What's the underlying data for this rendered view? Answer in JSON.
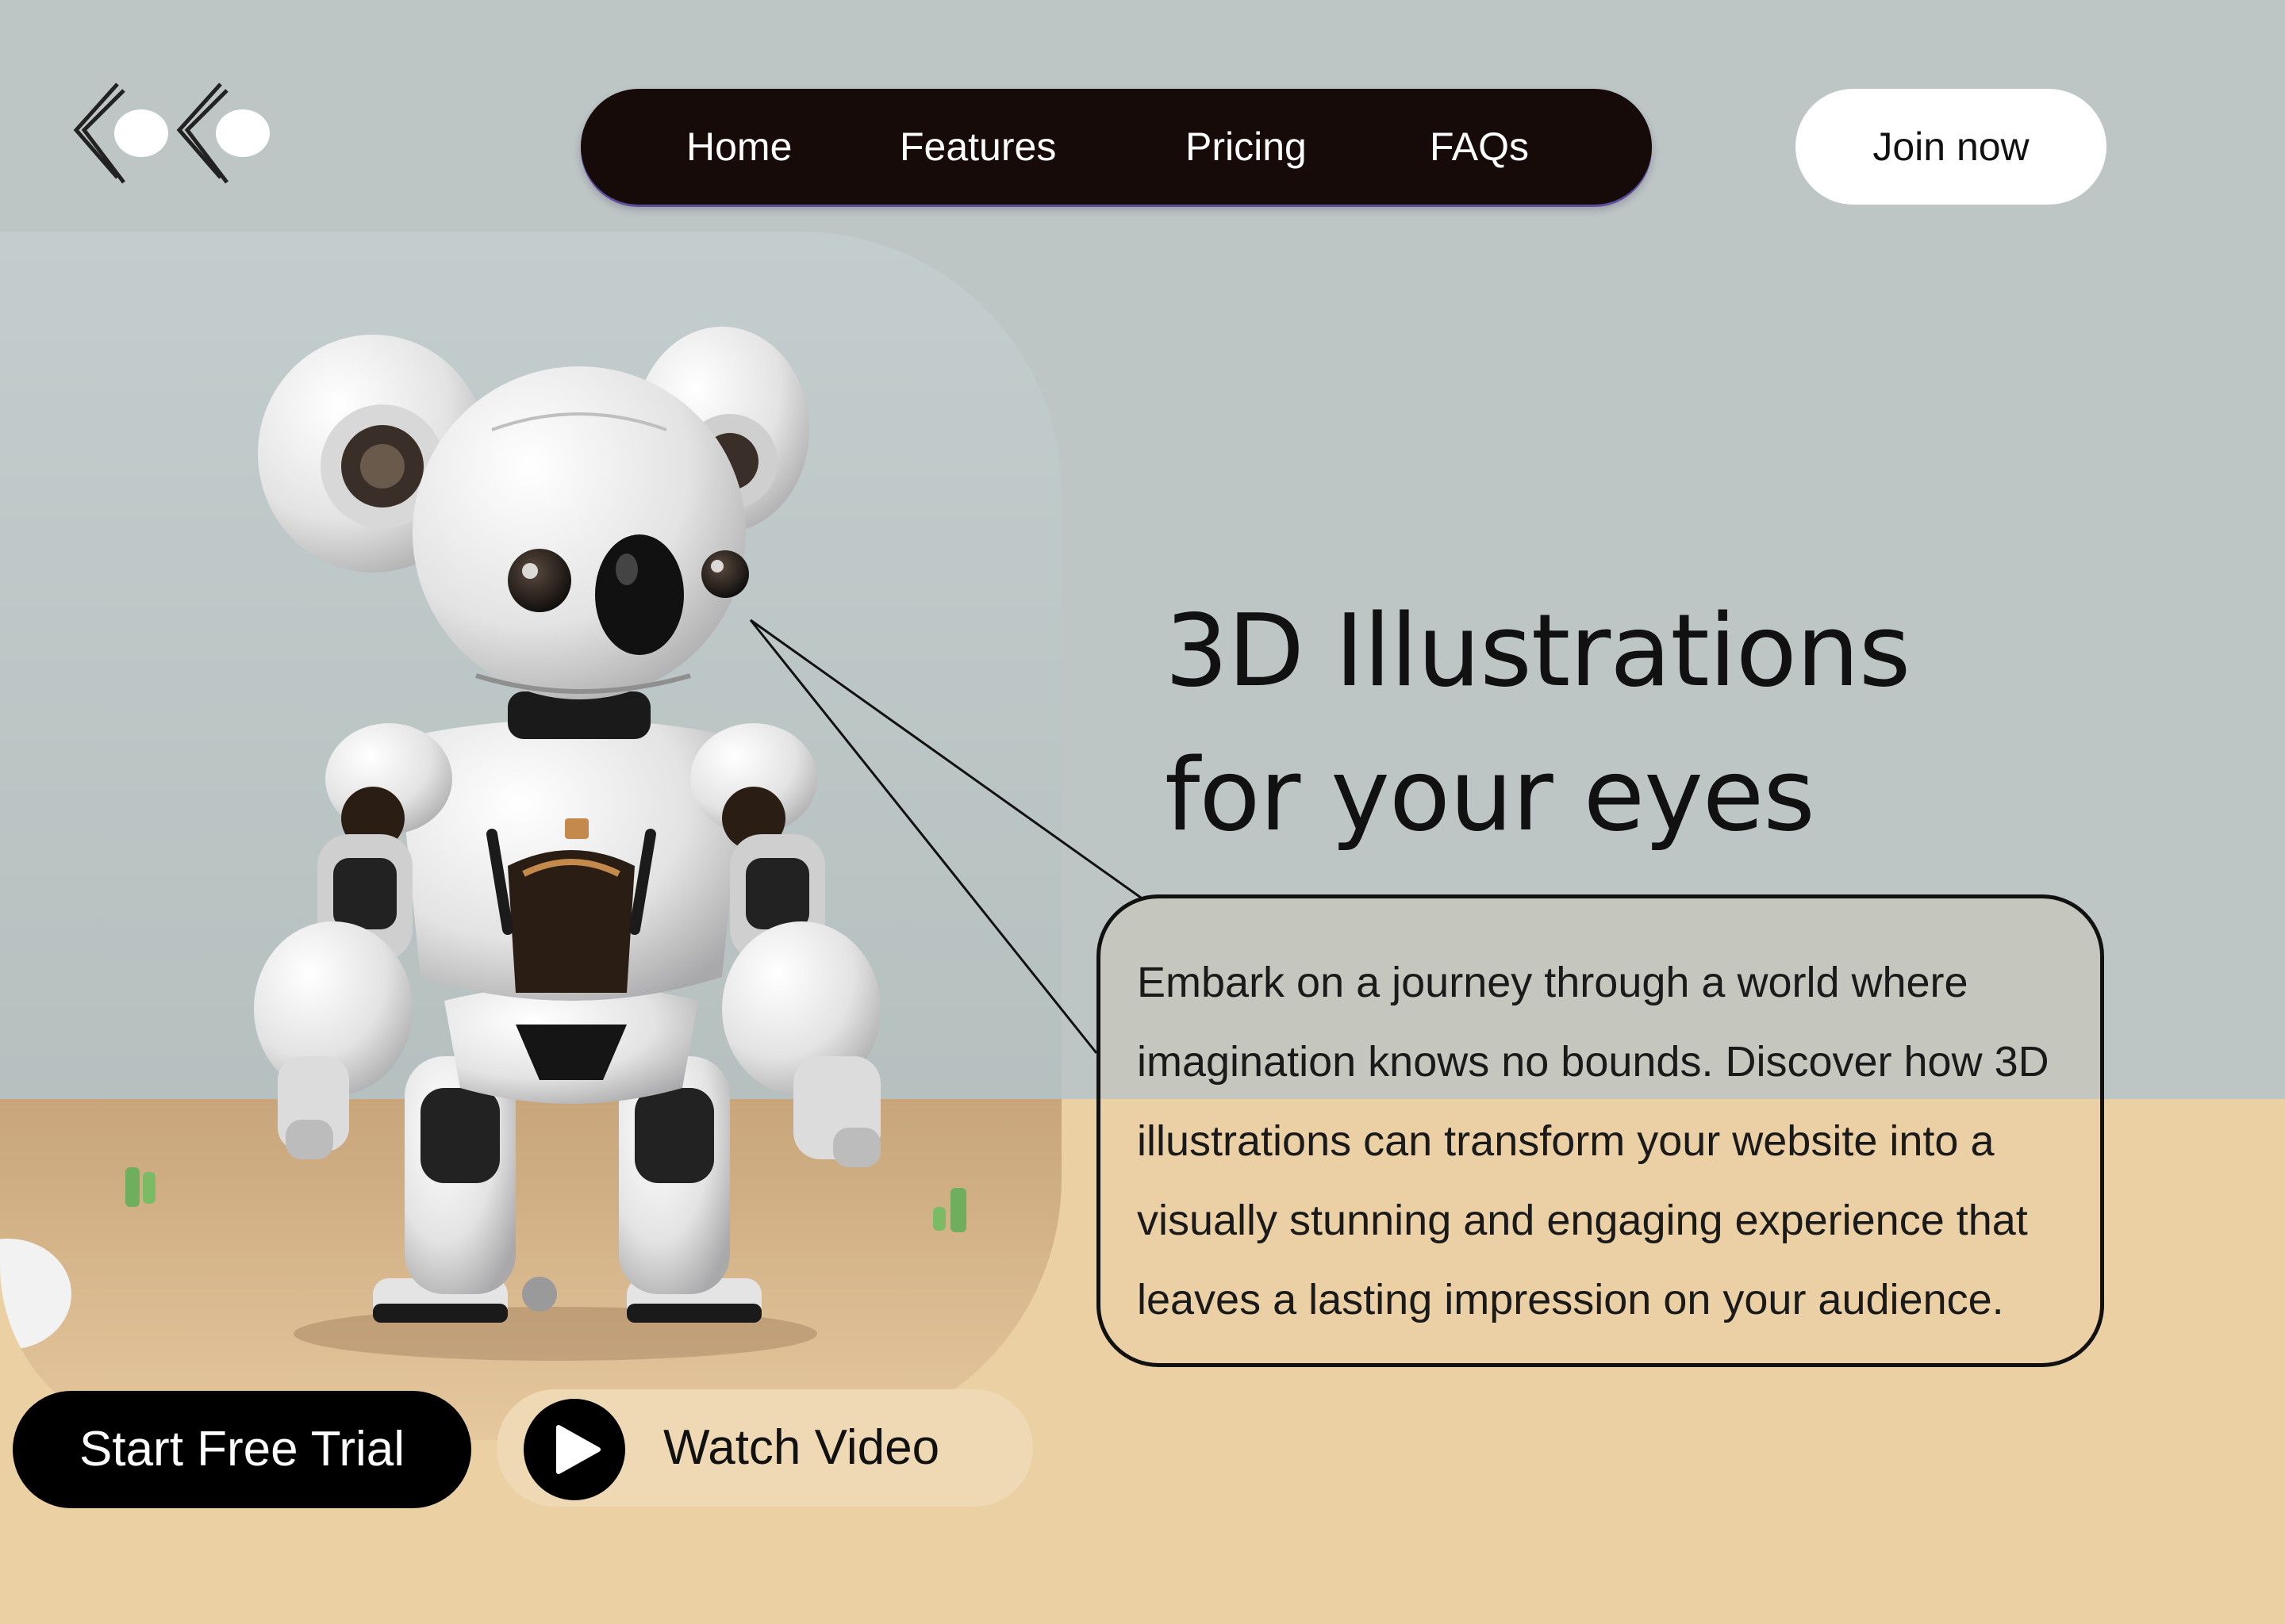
{
  "nav": {
    "items": [
      {
        "label": "Home"
      },
      {
        "label": "Features"
      },
      {
        "label": "Pricing"
      },
      {
        "label": "FAQs"
      }
    ],
    "join_label": "Join now"
  },
  "hero": {
    "headline_line1": "3D Illustrations",
    "headline_line2": "for your eyes",
    "description": "Embark on a journey through a world where imagination knows no bounds. Discover how 3D illustrations can transform your website into a visually stunning and engaging experience that leaves a lasting impression on your audience.",
    "image_icon": "robot-koala-illustration"
  },
  "cta": {
    "start_label": "Start Free Trial",
    "watch_label": "Watch Video",
    "play_icon": "play-icon"
  },
  "logo_icon": "double-chevron-logo",
  "colors": {
    "sky": "#bdc5c5",
    "ground": "#ebd0a4",
    "nav_bg": "#160b08",
    "accent_outline": "#5a4d9e",
    "text_dark": "#111111",
    "white": "#ffffff"
  }
}
